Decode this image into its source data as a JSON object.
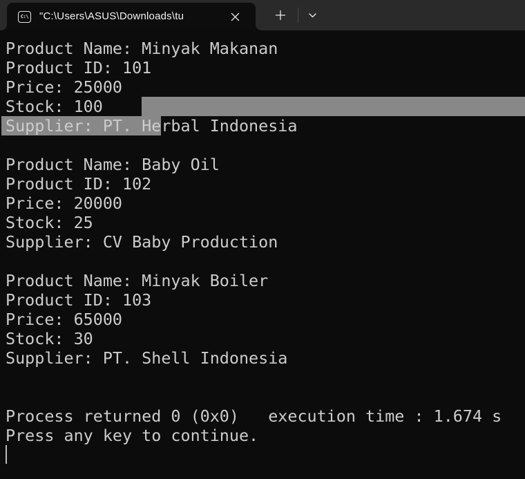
{
  "window": {
    "tab": {
      "icon": "cmd-icon",
      "icon_text": "C:\\",
      "title": "\"C:\\Users\\ASUS\\Downloads\\tu"
    },
    "controls": {
      "close_tab": "close tab",
      "new_tab": "new tab",
      "tab_dropdown": "open tab dropdown"
    }
  },
  "terminal": {
    "lines": [
      "Product Name: Minyak Makanan",
      "Product ID: 101",
      "Price: 25000",
      "Stock: 100",
      "Supplier: PT. Herbal Indonesia",
      "",
      "Product Name: Baby Oil",
      "Product ID: 102",
      "Price: 20000",
      "Stock: 25",
      "Supplier: CV Baby Production",
      "",
      "Product Name: Minyak Boiler",
      "Product ID: 103",
      "Price: 65000",
      "Stock: 30",
      "Supplier: PT. Shell Indonesia",
      "",
      "",
      "Process returned 0 (0x0)   execution time : 1.674 s",
      "Press any key to continue.",
      ""
    ],
    "products": [
      {
        "name": "Minyak Makanan",
        "id": "101",
        "price": "25000",
        "stock": "100",
        "supplier": "PT. Herbal Indonesia"
      },
      {
        "name": "Baby Oil",
        "id": "102",
        "price": "20000",
        "stock": "25",
        "supplier": "CV Baby Production"
      },
      {
        "name": "Minyak Boiler",
        "id": "103",
        "price": "65000",
        "stock": "30",
        "supplier": "PT. Shell Indonesia"
      }
    ],
    "status": {
      "return_code": "0 (0x0)",
      "execution_time": "1.674 s",
      "prompt": "Press any key to continue."
    },
    "selection": {
      "selected_text": "Supplier: PT. He",
      "spans_rows": "end of Stock: 100 row through column 16 of Supplier row"
    },
    "cursor": {
      "style": "bar",
      "visible": true
    }
  },
  "colors": {
    "terminal_bg": "#0c0c0c",
    "terminal_fg": "#cccccc",
    "titlebar_bg": "#2a2a2a",
    "tab_bg": "#0d0d0d",
    "selection_bg": "#888888",
    "icon_fg": "#e8e8e8"
  }
}
